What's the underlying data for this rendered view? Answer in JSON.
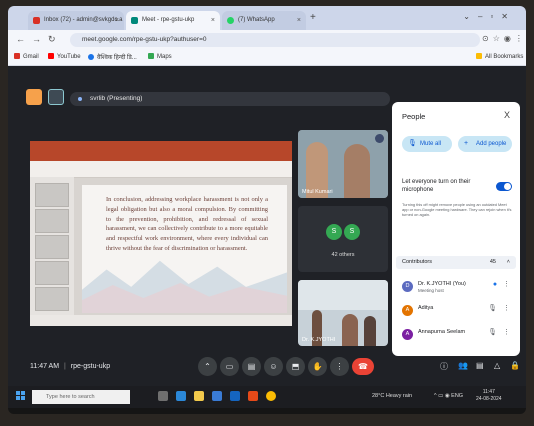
{
  "browser": {
    "tabs": [
      {
        "title": "Inbox (72) - admin@svkgdc.a",
        "favicon_color": "#d93025"
      },
      {
        "title": "Meet - rpe-gstu-ukp",
        "favicon_color": "#00897b"
      },
      {
        "title": "(7) WhatsApp",
        "favicon_color": "#25d366"
      }
    ],
    "new_tab": "+",
    "url": "meet.google.com/rpe-gstu-ukp?authuser=0",
    "bookmarks": [
      "Gmail",
      "YouTube",
      "वैश्विक हिन्दी डि...",
      "Maps"
    ],
    "all_bookmarks": "All Bookmarks"
  },
  "meet": {
    "presenter_label": "svrlib (Presenting)",
    "slide_text": "In conclusion, addressing workplace harassment is not only a legal obligation but also a moral compulsion. By committing to the prevention, prohibition, and redressal of sexual harassment, we can collectively contribute to a more equitable and respectful work environment, where every individual can thrive without the fear of discrimination or harassment.",
    "tiles": {
      "tile1_name": "Mitul Kumari",
      "tile2_avatars": [
        "S",
        "S"
      ],
      "tile2_label": "42 others",
      "tile3_name": "Dr. K.JYOTHI"
    },
    "people": {
      "title": "People",
      "close": "X",
      "mute_all": "Mute all",
      "add_people": "Add people",
      "let_everyone": "Let everyone turn on their microphone",
      "turn_off_note": "Turning this off might remove people using an outdated Meet app or non-Google meeting hardware. They can rejoin when it's turned on again.",
      "contributors_label": "Contributors",
      "contributors_count": "45",
      "participants": [
        {
          "name": "Dr. K.JYOTHI (You)",
          "sub": "Meeting host",
          "initial": "D",
          "color": "#5c6bc0"
        },
        {
          "name": "Aditya",
          "sub": "",
          "initial": "A",
          "color": "#e37400"
        },
        {
          "name": "Annapurna Seelam",
          "sub": "",
          "initial": "A",
          "color": "#7b1fa2"
        }
      ]
    },
    "time_code": "11:47 AM",
    "meeting_code": "rpe-gstu-ukp",
    "separator": "|"
  },
  "taskbar": {
    "search_placeholder": "Type here to search",
    "weather": "28°C Heavy rain",
    "lang": "ENG",
    "time": "11:47",
    "date": "24-08-2024"
  }
}
